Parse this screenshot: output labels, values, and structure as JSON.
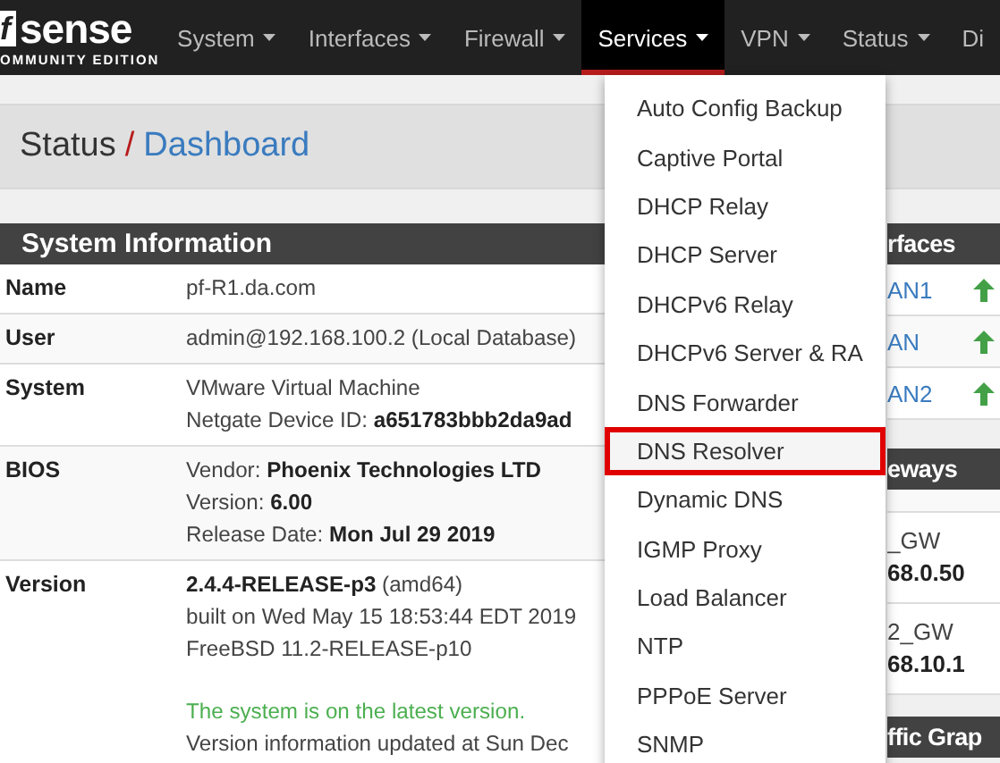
{
  "navbar": {
    "logo": {
      "mark": "f",
      "wordmark": "sense",
      "edition": "OMMUNITY EDITION"
    },
    "items": [
      {
        "label": "System",
        "caret": true,
        "selected": false
      },
      {
        "label": "Interfaces",
        "caret": true,
        "selected": false
      },
      {
        "label": "Firewall",
        "caret": true,
        "selected": false
      },
      {
        "label": "Services",
        "caret": true,
        "selected": true
      },
      {
        "label": "VPN",
        "caret": true,
        "selected": false
      },
      {
        "label": "Status",
        "caret": true,
        "selected": false
      },
      {
        "label": "Di",
        "caret": false,
        "selected": false
      }
    ]
  },
  "breadcrumb": {
    "parent": "Status",
    "separator": "/",
    "current": "Dashboard"
  },
  "system_info": {
    "title": "System Information",
    "rows": [
      {
        "label": "Name",
        "lines": [
          {
            "kind": "plain",
            "text": "pf-R1.da.com"
          }
        ]
      },
      {
        "label": "User",
        "lines": [
          {
            "kind": "plain",
            "text": "admin@192.168.100.2 (Local Database)"
          }
        ]
      },
      {
        "label": "System",
        "lines": [
          {
            "kind": "plain",
            "text": "VMware Virtual Machine"
          },
          {
            "kind": "plain",
            "text": "Netgate Device ID: **a651783bbb2da9ad**"
          }
        ]
      },
      {
        "label": "BIOS",
        "lines": [
          {
            "kind": "plain",
            "text": "Vendor: **Phoenix Technologies LTD**"
          },
          {
            "kind": "plain",
            "text": "Version: **6.00**"
          },
          {
            "kind": "plain",
            "text": "Release Date: **Mon Jul 29 2019**"
          }
        ]
      },
      {
        "label": "Version",
        "lines": [
          {
            "kind": "plain",
            "text": "**2.4.4-RELEASE-p3** (amd64)"
          },
          {
            "kind": "plain",
            "text": "built on Wed May 15 18:53:44 EDT 2019"
          },
          {
            "kind": "plain",
            "text": "FreeBSD 11.2-RELEASE-p10"
          },
          {
            "kind": "success",
            "text": "The system is on the latest version."
          },
          {
            "kind": "plain",
            "text": "Version information updated at Sun Dec"
          }
        ]
      }
    ]
  },
  "interfaces": {
    "title": "rfaces",
    "rows": [
      {
        "name": "AN1",
        "up": true
      },
      {
        "name": "AN",
        "up": true
      },
      {
        "name": "AN2",
        "up": true
      }
    ]
  },
  "gateways": {
    "title": "eways",
    "rows": [
      {
        "name": "_GW",
        "address": "68.0.50"
      },
      {
        "name": "2_GW",
        "address": "68.10.1"
      }
    ]
  },
  "traffic": {
    "title": "ffic Grap"
  },
  "services_menu": {
    "items": [
      {
        "label": "Auto Config Backup",
        "selected": false
      },
      {
        "label": "Captive Portal",
        "selected": false
      },
      {
        "label": "DHCP Relay",
        "selected": false
      },
      {
        "label": "DHCP Server",
        "selected": false
      },
      {
        "label": "DHCPv6 Relay",
        "selected": false
      },
      {
        "label": "DHCPv6 Server & RA",
        "selected": false
      },
      {
        "label": "DNS Forwarder",
        "selected": false
      },
      {
        "label": "DNS Resolver",
        "selected": true
      },
      {
        "label": "Dynamic DNS",
        "selected": false
      },
      {
        "label": "IGMP Proxy",
        "selected": false
      },
      {
        "label": "Load Balancer",
        "selected": false
      },
      {
        "label": "NTP",
        "selected": false
      },
      {
        "label": "PPPoE Server",
        "selected": false
      },
      {
        "label": "SNMP",
        "selected": false
      }
    ]
  }
}
